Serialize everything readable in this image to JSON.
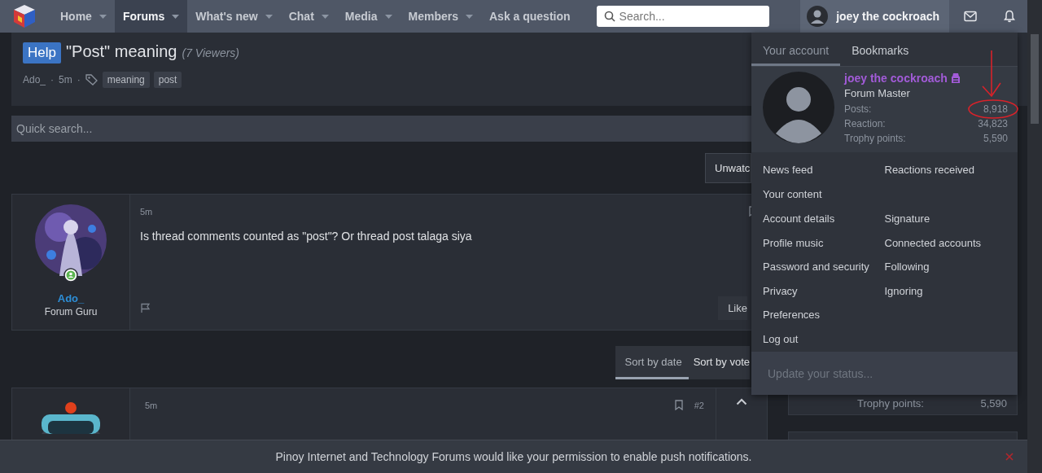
{
  "nav": {
    "items": [
      {
        "label": "Home",
        "selected": false,
        "dropdown": true
      },
      {
        "label": "Forums",
        "selected": true,
        "dropdown": true
      },
      {
        "label": "What's new",
        "selected": false,
        "dropdown": true
      },
      {
        "label": "Chat",
        "selected": false,
        "dropdown": true
      },
      {
        "label": "Media",
        "selected": false,
        "dropdown": true
      },
      {
        "label": "Members",
        "selected": false,
        "dropdown": true
      },
      {
        "label": "Ask a question",
        "selected": false,
        "dropdown": false
      }
    ],
    "search": {
      "placeholder": "Search..."
    },
    "user": {
      "name": "joey the cockroach"
    }
  },
  "thread": {
    "prefix": "Help",
    "title": "\"Post\" meaning",
    "viewers": "(7 Viewers)",
    "author": "Ado_",
    "separator": "·",
    "time": "5m",
    "tags": [
      "meaning",
      "post"
    ]
  },
  "quick_search": {
    "placeholder": "Quick search..."
  },
  "watch_button": "Unwatc",
  "posts": [
    {
      "author": "Ado_",
      "user_title": "Forum Guru",
      "online": true,
      "time": "5m",
      "body": "Is thread comments counted as \"post\"? Or thread post talaga siya",
      "like": "Like"
    },
    {
      "time": "5m",
      "number": "#2"
    }
  ],
  "sort_tabs": [
    {
      "label": "Sort by date",
      "selected": true
    },
    {
      "label": "Sort by vote",
      "selected": false
    }
  ],
  "sidebar": {
    "stat_label": "Trophy points:",
    "stat_value": "5,590"
  },
  "account_menu": {
    "tabs": [
      {
        "label": "Your account",
        "selected": true
      },
      {
        "label": "Bookmarks",
        "selected": false
      }
    ],
    "name": "joey the cockroach",
    "user_title": "Forum Master",
    "stats": [
      {
        "label": "Posts:",
        "value": "8,918"
      },
      {
        "label": "Reaction:",
        "value": "34,823"
      },
      {
        "label": "Trophy points:",
        "value": "5,590"
      }
    ],
    "links": [
      {
        "left": "News feed",
        "right": "Reactions received"
      },
      {
        "left": "Your content"
      },
      {
        "left": "Account details",
        "right": "Signature"
      },
      {
        "left": "Profile music",
        "right": "Connected accounts"
      },
      {
        "left": "Password and security",
        "right": "Following"
      },
      {
        "left": "Privacy",
        "right": "Ignoring"
      },
      {
        "left": "Preferences"
      },
      {
        "left": "Log out"
      }
    ],
    "status": {
      "placeholder": "Update your status..."
    }
  },
  "notification": {
    "text": "Pinoy Internet and Technology Forums would like your permission to enable push notifications."
  }
}
